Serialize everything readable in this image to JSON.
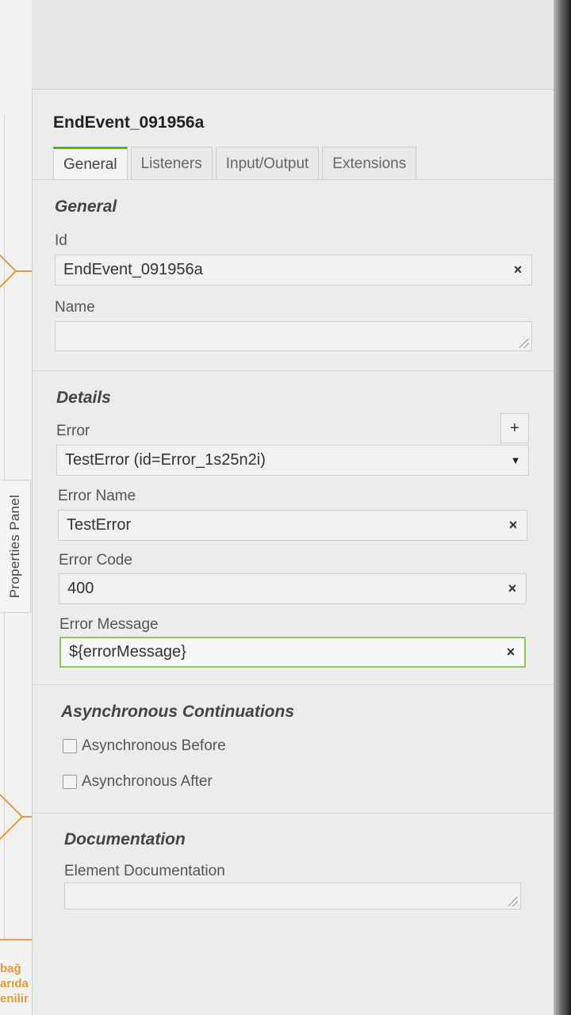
{
  "canvas": {
    "panel_toggle_label": "Properties Panel",
    "partial_text_lines": [
      "bağ",
      "arıda",
      "enilir"
    ]
  },
  "panel": {
    "element_title": "EndEvent_091956a",
    "tabs": [
      {
        "label": "General",
        "active": true
      },
      {
        "label": "Listeners",
        "active": false
      },
      {
        "label": "Input/Output",
        "active": false
      },
      {
        "label": "Extensions",
        "active": false
      }
    ],
    "general": {
      "section_title": "General",
      "id_label": "Id",
      "id_value": "EndEvent_091956a",
      "name_label": "Name",
      "name_value": ""
    },
    "details": {
      "section_title": "Details",
      "error_label": "Error",
      "error_selected": "TestError (id=Error_1s25n2i)",
      "error_name_label": "Error Name",
      "error_name_value": "TestError",
      "error_code_label": "Error Code",
      "error_code_value": "400",
      "error_message_label": "Error Message",
      "error_message_value": "${errorMessage}"
    },
    "async": {
      "section_title": "Asynchronous Continuations",
      "before_label": "Asynchronous Before",
      "after_label": "Asynchronous After"
    },
    "documentation": {
      "section_title": "Documentation",
      "element_doc_label": "Element Documentation",
      "element_doc_value": ""
    },
    "icons": {
      "clear": "×",
      "add": "+",
      "dropdown": "▼"
    }
  },
  "colors": {
    "accent_green": "#52b415",
    "focus_green": "#8dc75e",
    "shape_orange": "#e39a3a"
  }
}
